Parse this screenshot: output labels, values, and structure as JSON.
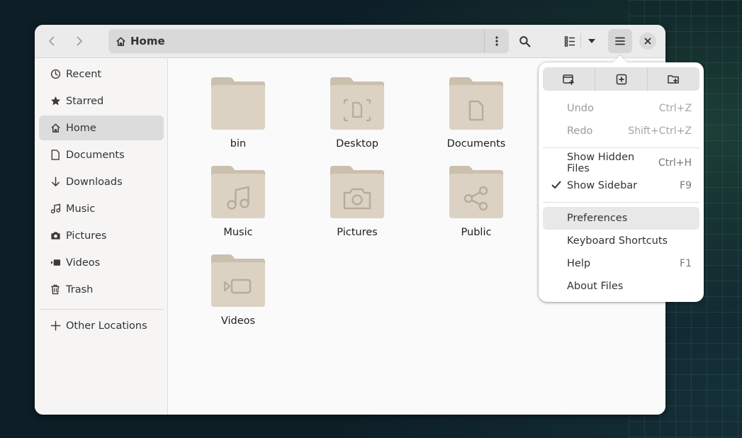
{
  "colors": {
    "folder_fill": "#dcd2c4",
    "folder_back": "#cbbfae",
    "folder_glyph": "#b8ab98",
    "accent_active": "#dcdcdc"
  },
  "headerbar": {
    "path_label": "Home",
    "icons": [
      "go-previous-icon",
      "go-next-icon",
      "home-icon",
      "kebab-menu-icon",
      "search-icon",
      "list-view-icon",
      "chevron-down-icon",
      "hamburger-menu-icon",
      "close-icon"
    ]
  },
  "sidebar": {
    "items": [
      {
        "label": "Recent",
        "icon": "clock-icon"
      },
      {
        "label": "Starred",
        "icon": "star-icon"
      },
      {
        "label": "Home",
        "icon": "home-icon",
        "active": true
      },
      {
        "label": "Documents",
        "icon": "document-icon"
      },
      {
        "label": "Downloads",
        "icon": "download-icon"
      },
      {
        "label": "Music",
        "icon": "music-icon"
      },
      {
        "label": "Pictures",
        "icon": "camera-icon"
      },
      {
        "label": "Videos",
        "icon": "video-icon"
      },
      {
        "label": "Trash",
        "icon": "trash-icon"
      }
    ],
    "other_locations": "Other Locations"
  },
  "folders": [
    {
      "name": "bin",
      "glyph": "none"
    },
    {
      "name": "Desktop",
      "glyph": "desktop"
    },
    {
      "name": "Documents",
      "glyph": "document"
    },
    {
      "name": "Music",
      "glyph": "music"
    },
    {
      "name": "Pictures",
      "glyph": "camera"
    },
    {
      "name": "Public",
      "glyph": "share"
    },
    {
      "name": "Videos",
      "glyph": "video"
    }
  ],
  "menu": {
    "top_buttons": [
      "new-window-icon",
      "new-tab-icon",
      "new-folder-icon"
    ],
    "undo": {
      "label": "Undo",
      "accel": "Ctrl+Z"
    },
    "redo": {
      "label": "Redo",
      "accel": "Shift+Ctrl+Z"
    },
    "show_hidden": {
      "label": "Show Hidden Files",
      "accel": "Ctrl+H"
    },
    "show_sidebar": {
      "label": "Show Sidebar",
      "accel": "F9",
      "checked": true
    },
    "preferences": {
      "label": "Preferences"
    },
    "shortcuts": {
      "label": "Keyboard Shortcuts"
    },
    "help": {
      "label": "Help",
      "accel": "F1"
    },
    "about": {
      "label": "About Files"
    }
  }
}
